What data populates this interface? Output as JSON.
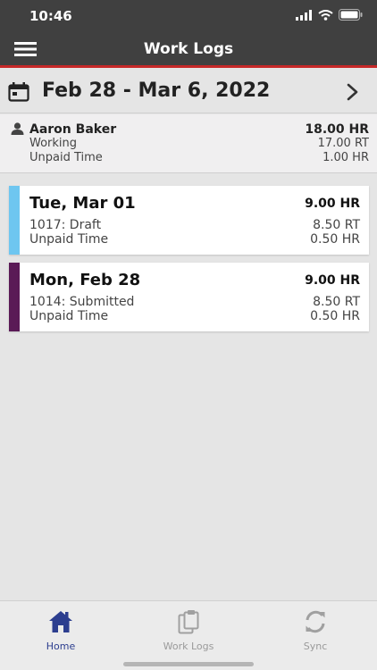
{
  "status": {
    "time": "10:46"
  },
  "header": {
    "title": "Work Logs"
  },
  "range": {
    "label": "Feb 28 - Mar 6, 2022"
  },
  "summary": {
    "name": "Aaron Baker",
    "total": "18.00 HR",
    "working_label": "Working",
    "working_value": "17.00 RT",
    "unpaid_label": "Unpaid Time",
    "unpaid_value": "1.00 HR"
  },
  "days": [
    {
      "day": "Tue, Mar 01",
      "total": "9.00 HR",
      "status": "1017: Draft",
      "status_value": "8.50 RT",
      "unpaid_label": "Unpaid Time",
      "unpaid_value": "0.50 HR",
      "color": "#6ec6f0"
    },
    {
      "day": "Mon, Feb 28",
      "total": "9.00 HR",
      "status": "1014: Submitted",
      "status_value": "8.50 RT",
      "unpaid_label": "Unpaid Time",
      "unpaid_value": "0.50 HR",
      "color": "#5a1a56"
    }
  ],
  "tabs": [
    {
      "label": "Home",
      "icon": "home-icon",
      "active": true
    },
    {
      "label": "Work Logs",
      "icon": "clipboard-icon",
      "active": false
    },
    {
      "label": "Sync",
      "icon": "sync-icon",
      "active": false
    }
  ],
  "colors": {
    "accent": "#c62828",
    "nav": "#404040",
    "active_tab": "#2c3e8f"
  }
}
